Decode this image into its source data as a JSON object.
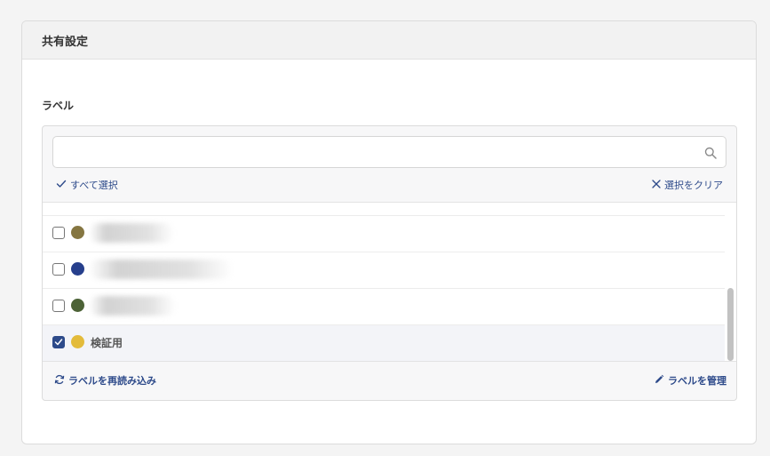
{
  "section": {
    "title": "共有設定"
  },
  "labels_field": {
    "label": "ラベル",
    "search": {
      "value": "",
      "placeholder": ""
    },
    "select_all": "すべて選択",
    "clear_selection": "選択をクリア",
    "items": [
      {
        "name": "",
        "color": "#857641",
        "checked": false,
        "text_obscured": true
      },
      {
        "name": "",
        "color": "#263f8c",
        "checked": false,
        "text_obscured": true
      },
      {
        "name": "",
        "color": "#4c6236",
        "checked": false,
        "text_obscured": true
      },
      {
        "name": "検証用",
        "color": "#e3bb3b",
        "checked": true,
        "text_obscured": false
      }
    ],
    "reload": "ラベルを再読み込み",
    "manage": "ラベルを管理"
  },
  "colors": {
    "accent": "#2d4a8a"
  },
  "icons": {
    "search": "search-icon",
    "select_all": "checkmark-icon",
    "clear": "close-icon",
    "reload": "refresh-icon",
    "manage": "pencil-icon"
  }
}
